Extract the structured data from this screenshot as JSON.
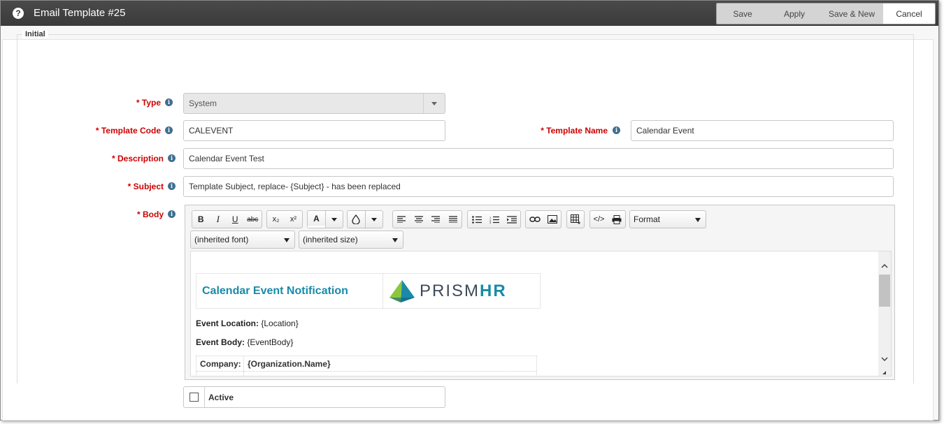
{
  "window": {
    "title": "Email Template #25",
    "help_icon": "help-icon"
  },
  "actions": {
    "save": "Save",
    "apply": "Apply",
    "save_new": "Save & New",
    "cancel": "Cancel"
  },
  "section": {
    "legend": "Initial"
  },
  "fields": {
    "type": {
      "label": "* Type",
      "value": "System"
    },
    "template_code": {
      "label": "* Template Code",
      "value": "CALEVENT"
    },
    "template_name": {
      "label": "* Template Name",
      "value": "Calendar Event"
    },
    "description": {
      "label": "* Description",
      "value": "Calendar Event Test"
    },
    "subject": {
      "label": "* Subject",
      "value": "Template Subject, replace- {Subject} - has been replaced"
    },
    "body": {
      "label": "* Body"
    },
    "active": {
      "label": "Active",
      "checked": false
    }
  },
  "toolbar": {
    "bold": "B",
    "italic": "I",
    "underline": "U",
    "strike": "abc",
    "subscript": "x₂",
    "superscript": "x²",
    "font_color": "A",
    "format": "Format",
    "font": "(inherited font)",
    "size": "(inherited size)"
  },
  "editor": {
    "heading": "Calendar Event Notification",
    "logo_prefix": "PRISM",
    "logo_suffix": "HR",
    "location_label": "Event Location:",
    "location_value": " {Location}",
    "body_label": "Event Body:",
    "body_value": " {EventBody}",
    "company_label": "Company:",
    "company_value": "{Organization.Name}"
  },
  "colors": {
    "required": "#cc0000",
    "heading": "#1a8aa8",
    "titlebar": "#3a3a3a"
  }
}
